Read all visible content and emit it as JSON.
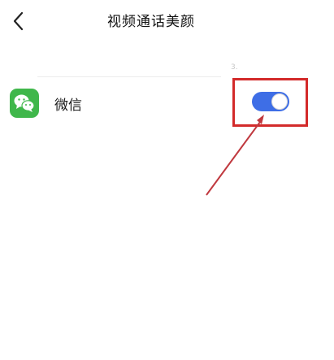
{
  "header": {
    "title": "视频通话美颜",
    "back_icon": "chevron-left-icon"
  },
  "divider_mark": "3.",
  "app_list": [
    {
      "name": "微信",
      "icon": "wechat-icon",
      "toggle_on": true
    }
  ],
  "colors": {
    "toggle_on": "#3e6ee6",
    "wechat_green": "#40b74b",
    "annotation_red": "#d32a2a"
  }
}
